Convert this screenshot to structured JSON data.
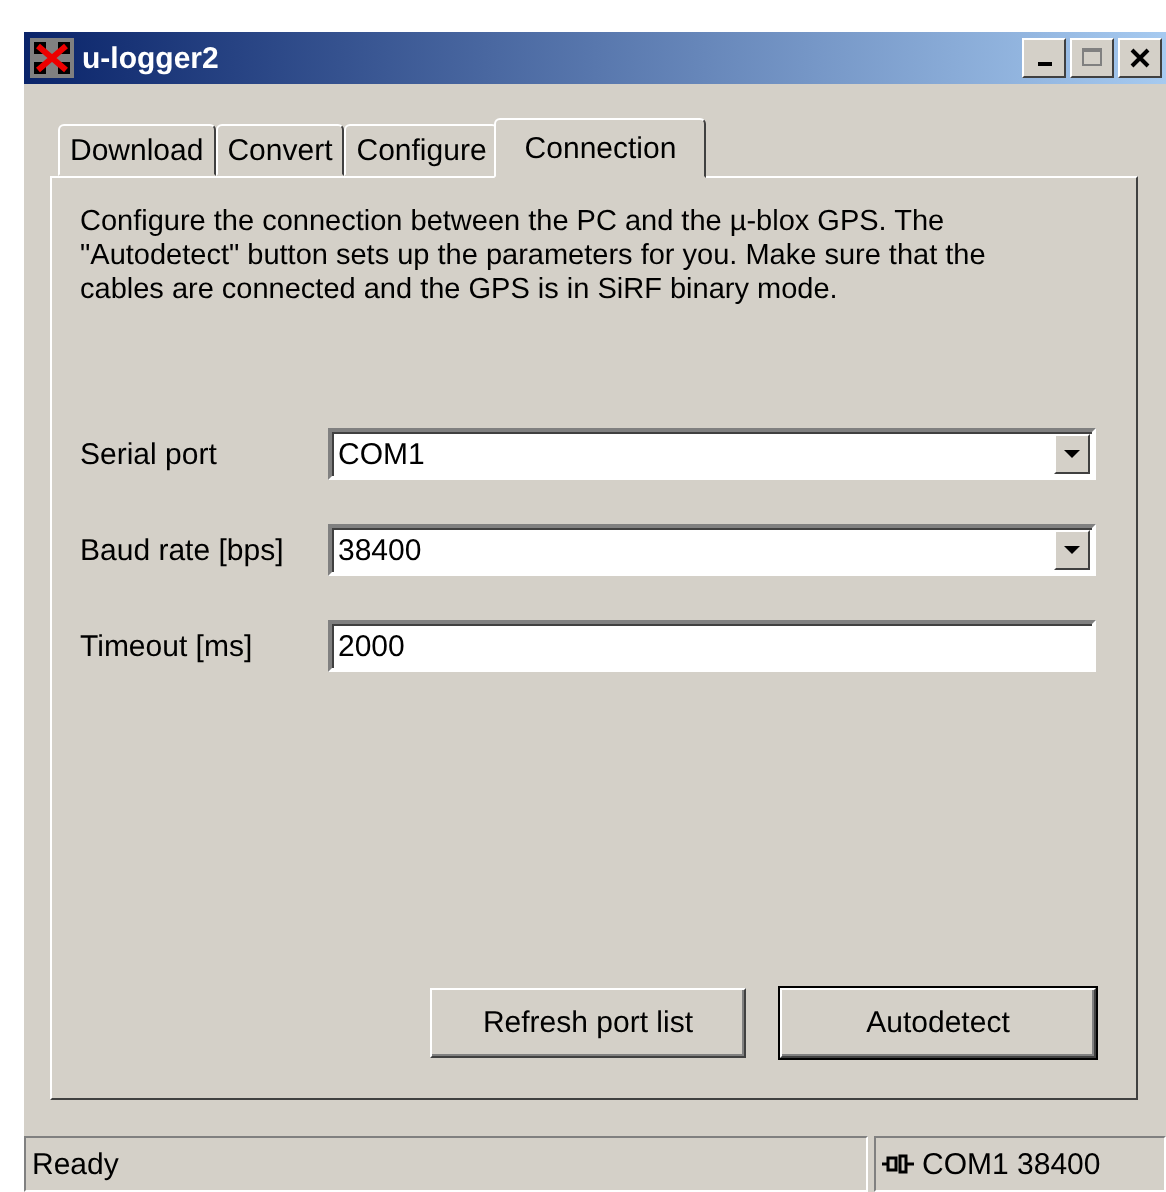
{
  "window": {
    "title": "u-logger2"
  },
  "tabs": [
    {
      "label": "Download",
      "selected": false
    },
    {
      "label": "Convert",
      "selected": false
    },
    {
      "label": "Configure",
      "selected": false
    },
    {
      "label": "Connection",
      "selected": true
    }
  ],
  "description": "Configure the connection between the PC and the µ-blox GPS. The \"Autodetect\" button sets up the parameters for you. Make sure that the cables are connected and the GPS is in SiRF binary mode.",
  "fields": [
    {
      "kind": "combo",
      "label": "Serial port",
      "value": "COM1"
    },
    {
      "kind": "combo",
      "label": "Baud rate [bps]",
      "value": "38400"
    },
    {
      "kind": "text",
      "label": "Timeout [ms]",
      "value": "2000"
    }
  ],
  "buttons": [
    {
      "label": "Refresh port list",
      "default": false
    },
    {
      "label": "Autodetect",
      "default": true
    }
  ],
  "status_bar": {
    "message": "Ready",
    "connection": "COM1 38400"
  }
}
